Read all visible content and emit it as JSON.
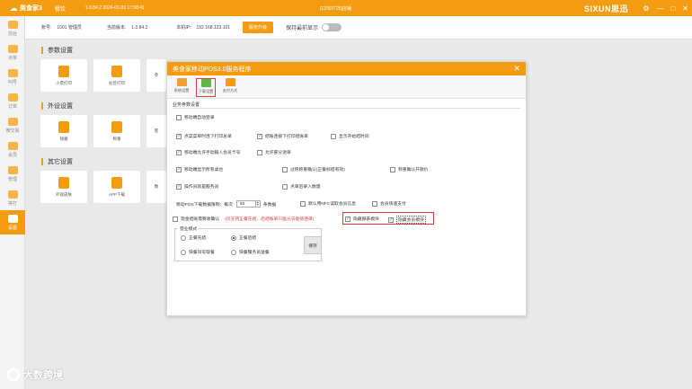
{
  "titlebar": {
    "app_logo": "美食家3",
    "module": "餐饮",
    "version": "1.0.84.2 2024-01-09 17:58:41",
    "store": "[12003725]店铺",
    "brand": "SIXUN思迅",
    "minimize": "—",
    "maximize": "□",
    "close": "✕"
  },
  "sidebar": {
    "items": [
      {
        "label": "前台",
        "icon": "home-icon"
      },
      {
        "label": "点单",
        "icon": "order-icon"
      },
      {
        "label": "叫号",
        "icon": "call-icon"
      },
      {
        "label": "订单",
        "icon": "list-icon"
      },
      {
        "label": "微交易",
        "icon": "trade-icon"
      },
      {
        "label": "会员",
        "icon": "member-icon"
      },
      {
        "label": "管理",
        "icon": "manage-icon"
      },
      {
        "label": "排打",
        "icon": "print-icon"
      },
      {
        "label": "设置",
        "icon": "gear-icon"
      }
    ],
    "active_index": 8
  },
  "infobar": {
    "account_label": "账号:",
    "account_value": "1001 管理员",
    "current_version_label": "当前版本:",
    "current_version_value": "1.0.84.2",
    "ip_label": "本机IP:",
    "ip_value": "192.168.123.101",
    "action_button": "服务升级",
    "keep_screen_label": "保持最前显示"
  },
  "main": {
    "param_title": "参数设置",
    "param_tiles": [
      "小票打印",
      "标签打印",
      "参"
    ],
    "peripheral_title": "外设设置",
    "peripheral_tiles": [
      "钱箱",
      "称重",
      "客"
    ],
    "other_title": "其它设置",
    "other_tiles": [
      "外观皮肤",
      "APP下载",
      "数"
    ]
  },
  "dialog": {
    "title": "美食家移动POS3.0服务程序",
    "close": "✕",
    "toolbar": [
      {
        "label": "系统设置",
        "icon": "system-settings-icon",
        "color": "#f0a030"
      },
      {
        "label": "下载设置",
        "icon": "download-settings-icon",
        "color": "#62b543"
      },
      {
        "label": "支付方式",
        "icon": "payment-method-icon",
        "color": "#f39c12"
      }
    ],
    "group_title": "业务参数设置",
    "options": {
      "auto_login": "移动端自动登录",
      "print_order_summary": "点菜菜单时连下打印总单",
      "print_chit": "结账连接下打印结账单",
      "show_open_time": "显示开始结时间",
      "manual_member": "移动端允许手动输入会员卡号",
      "allow_partial_return": "允许部分退单",
      "show_all_tables": "移动端显示所有桌台",
      "over_weight_confirm": "过称称重确认(正餐标结有效)",
      "weigh_auto": "称重确认开款价",
      "select_waiter": "操作员就是服务员",
      "after_order_count": "点单后录入数量",
      "download_limit_prefix": "移动POS下载数据限制：每次",
      "download_limit_value": "50",
      "download_limit_suffix": "条数据",
      "nfc_member": "默认用NFC读取会员信息",
      "member_quick_pay": "会员快速支付",
      "cash_collect_confirm": "现金结账需要收确认",
      "red_note": "(仅支持正餐先结、后结账单只能从去能够连单)",
      "hide_lock_module": "隐藏报表模块",
      "hide_member_module": "隐藏会员模块"
    },
    "checked": {
      "auto_login": false,
      "print_order_summary": true,
      "print_chit": true,
      "show_open_time": false,
      "manual_member": true,
      "allow_partial_return": false,
      "show_all_tables": true,
      "over_weight_confirm": false,
      "weigh_auto": false,
      "select_waiter": true,
      "after_order_count": false,
      "nfc_member": false,
      "member_quick_pay": false,
      "cash_collect_confirm": false,
      "hide_lock_module": true,
      "hide_member_module": true
    },
    "business_mode": {
      "legend": "营业模式",
      "options": [
        "正餐先结",
        "正餐后结",
        "快餐叫号取餐",
        "快餐服务员送餐"
      ],
      "selected_index": 1,
      "save_button": "保存"
    }
  },
  "watermark": "大数跨境",
  "colors": {
    "accent": "#f39c12",
    "highlight": "#e53935"
  }
}
